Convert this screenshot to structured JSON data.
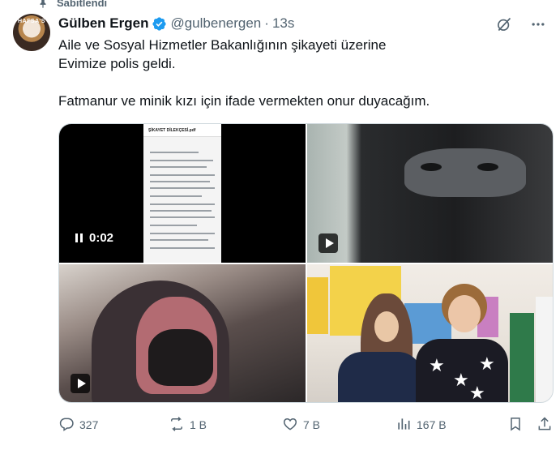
{
  "pinned": {
    "label": "Sabitlendi"
  },
  "author": {
    "name": "Gülben Ergen",
    "handle": "@gulbenergen",
    "separator": "·",
    "time": "13s",
    "avatar_text": "HAFSA'S"
  },
  "tweet": {
    "paragraph1": "Aile ve Sosyal Hizmetler Bakanlığının şikayeti üzerine\nEvimize polis geldi.",
    "paragraph2": "Fatmanur ve minik kızı için ifade vermekten onur duyacağım."
  },
  "media": {
    "video1_duration": "0:02",
    "doc_title": "ŞİKAYET DİLEKÇESİ.pdf"
  },
  "actions": {
    "replies": "327",
    "reposts": "1 B",
    "likes": "7 B",
    "views": "167 B"
  },
  "icons": {
    "pin": "pin-icon",
    "verified": "verified-badge-icon",
    "grok": "grok-icon",
    "more": "more-icon",
    "reply": "reply-icon",
    "repost": "repost-icon",
    "like": "heart-icon",
    "views": "views-icon",
    "bookmark": "bookmark-icon",
    "share": "share-icon"
  },
  "colors": {
    "verified": "#1d9bf0",
    "muted": "#536471",
    "text": "#0f1419"
  }
}
